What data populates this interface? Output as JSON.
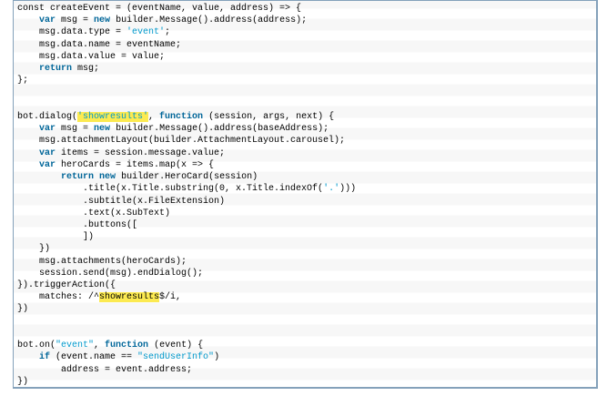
{
  "colors": {
    "background": "#ffffff",
    "border": "#84a1ba",
    "stripe": "#f7f7f7",
    "text": "#000000",
    "keyword": "#006699",
    "string": "#0099cc",
    "highlight": "#fcea51"
  },
  "code": {
    "language": "javascript",
    "highlighted_term": "showresults",
    "lines": [
      {
        "tokens": [
          {
            "c": "plain",
            "t": "const createEvent = (eventName, value, address) => {"
          }
        ]
      },
      {
        "tokens": [
          {
            "c": "plain",
            "t": "    "
          },
          {
            "c": "kw",
            "t": "var"
          },
          {
            "c": "plain",
            "t": " msg = "
          },
          {
            "c": "kw",
            "t": "new"
          },
          {
            "c": "plain",
            "t": " builder.Message().address(address);"
          }
        ]
      },
      {
        "tokens": [
          {
            "c": "plain",
            "t": "    msg.data.type = "
          },
          {
            "c": "str",
            "t": "'event'"
          },
          {
            "c": "plain",
            "t": ";"
          }
        ]
      },
      {
        "tokens": [
          {
            "c": "plain",
            "t": "    msg.data.name = eventName;"
          }
        ]
      },
      {
        "tokens": [
          {
            "c": "plain",
            "t": "    msg.data.value = value;"
          }
        ]
      },
      {
        "tokens": [
          {
            "c": "plain",
            "t": "    "
          },
          {
            "c": "kw",
            "t": "return"
          },
          {
            "c": "plain",
            "t": " msg;"
          }
        ]
      },
      {
        "tokens": [
          {
            "c": "plain",
            "t": "};"
          }
        ]
      },
      {
        "tokens": []
      },
      {
        "tokens": []
      },
      {
        "tokens": [
          {
            "c": "plain",
            "t": "bot.dialog("
          },
          {
            "c": "strhl",
            "t": "'showresults'"
          },
          {
            "c": "plain",
            "t": ", "
          },
          {
            "c": "kw",
            "t": "function"
          },
          {
            "c": "plain",
            "t": " (session, args, next) {"
          }
        ]
      },
      {
        "tokens": [
          {
            "c": "plain",
            "t": "    "
          },
          {
            "c": "kw",
            "t": "var"
          },
          {
            "c": "plain",
            "t": " msg = "
          },
          {
            "c": "kw",
            "t": "new"
          },
          {
            "c": "plain",
            "t": " builder.Message().address(baseAddress);"
          }
        ]
      },
      {
        "tokens": [
          {
            "c": "plain",
            "t": "    msg.attachmentLayout(builder.AttachmentLayout.carousel);"
          }
        ]
      },
      {
        "tokens": [
          {
            "c": "plain",
            "t": "    "
          },
          {
            "c": "kw",
            "t": "var"
          },
          {
            "c": "plain",
            "t": " items = session.message.value;"
          }
        ]
      },
      {
        "tokens": [
          {
            "c": "plain",
            "t": "    "
          },
          {
            "c": "kw",
            "t": "var"
          },
          {
            "c": "plain",
            "t": " heroCards = items.map(x => {"
          }
        ]
      },
      {
        "tokens": [
          {
            "c": "plain",
            "t": "        "
          },
          {
            "c": "kw",
            "t": "return"
          },
          {
            "c": "plain",
            "t": " "
          },
          {
            "c": "kw",
            "t": "new"
          },
          {
            "c": "plain",
            "t": " builder.HeroCard(session)"
          }
        ]
      },
      {
        "tokens": [
          {
            "c": "plain",
            "t": "            .title(x.Title.substring(0, x.Title.indexOf("
          },
          {
            "c": "str",
            "t": "'.'"
          },
          {
            "c": "plain",
            "t": ")))"
          }
        ]
      },
      {
        "tokens": [
          {
            "c": "plain",
            "t": "            .subtitle(x.FileExtension)"
          }
        ]
      },
      {
        "tokens": [
          {
            "c": "plain",
            "t": "            .text(x.SubText)"
          }
        ]
      },
      {
        "tokens": [
          {
            "c": "plain",
            "t": "            .buttons(["
          }
        ]
      },
      {
        "tokens": [
          {
            "c": "plain",
            "t": "            ])"
          }
        ]
      },
      {
        "tokens": [
          {
            "c": "plain",
            "t": "    })"
          }
        ]
      },
      {
        "tokens": [
          {
            "c": "plain",
            "t": "    msg.attachments(heroCards);"
          }
        ]
      },
      {
        "tokens": [
          {
            "c": "plain",
            "t": "    session.send(msg).endDialog();"
          }
        ]
      },
      {
        "tokens": [
          {
            "c": "plain",
            "t": "}).triggerAction({"
          }
        ]
      },
      {
        "tokens": [
          {
            "c": "plain",
            "t": "    matches: /^"
          },
          {
            "c": "hl",
            "t": "showresults"
          },
          {
            "c": "plain",
            "t": "$/i,"
          }
        ]
      },
      {
        "tokens": [
          {
            "c": "plain",
            "t": "})"
          }
        ]
      },
      {
        "tokens": []
      },
      {
        "tokens": []
      },
      {
        "tokens": [
          {
            "c": "plain",
            "t": "bot.on("
          },
          {
            "c": "str",
            "t": "\"event\""
          },
          {
            "c": "plain",
            "t": ", "
          },
          {
            "c": "kw",
            "t": "function"
          },
          {
            "c": "plain",
            "t": " (event) {"
          }
        ]
      },
      {
        "tokens": [
          {
            "c": "plain",
            "t": "    "
          },
          {
            "c": "kw",
            "t": "if"
          },
          {
            "c": "plain",
            "t": " (event.name == "
          },
          {
            "c": "str",
            "t": "\"sendUserInfo\""
          },
          {
            "c": "plain",
            "t": ")"
          }
        ]
      },
      {
        "tokens": [
          {
            "c": "plain",
            "t": "        address = event.address;"
          }
        ]
      },
      {
        "tokens": [
          {
            "c": "plain",
            "t": "})"
          }
        ]
      }
    ]
  }
}
